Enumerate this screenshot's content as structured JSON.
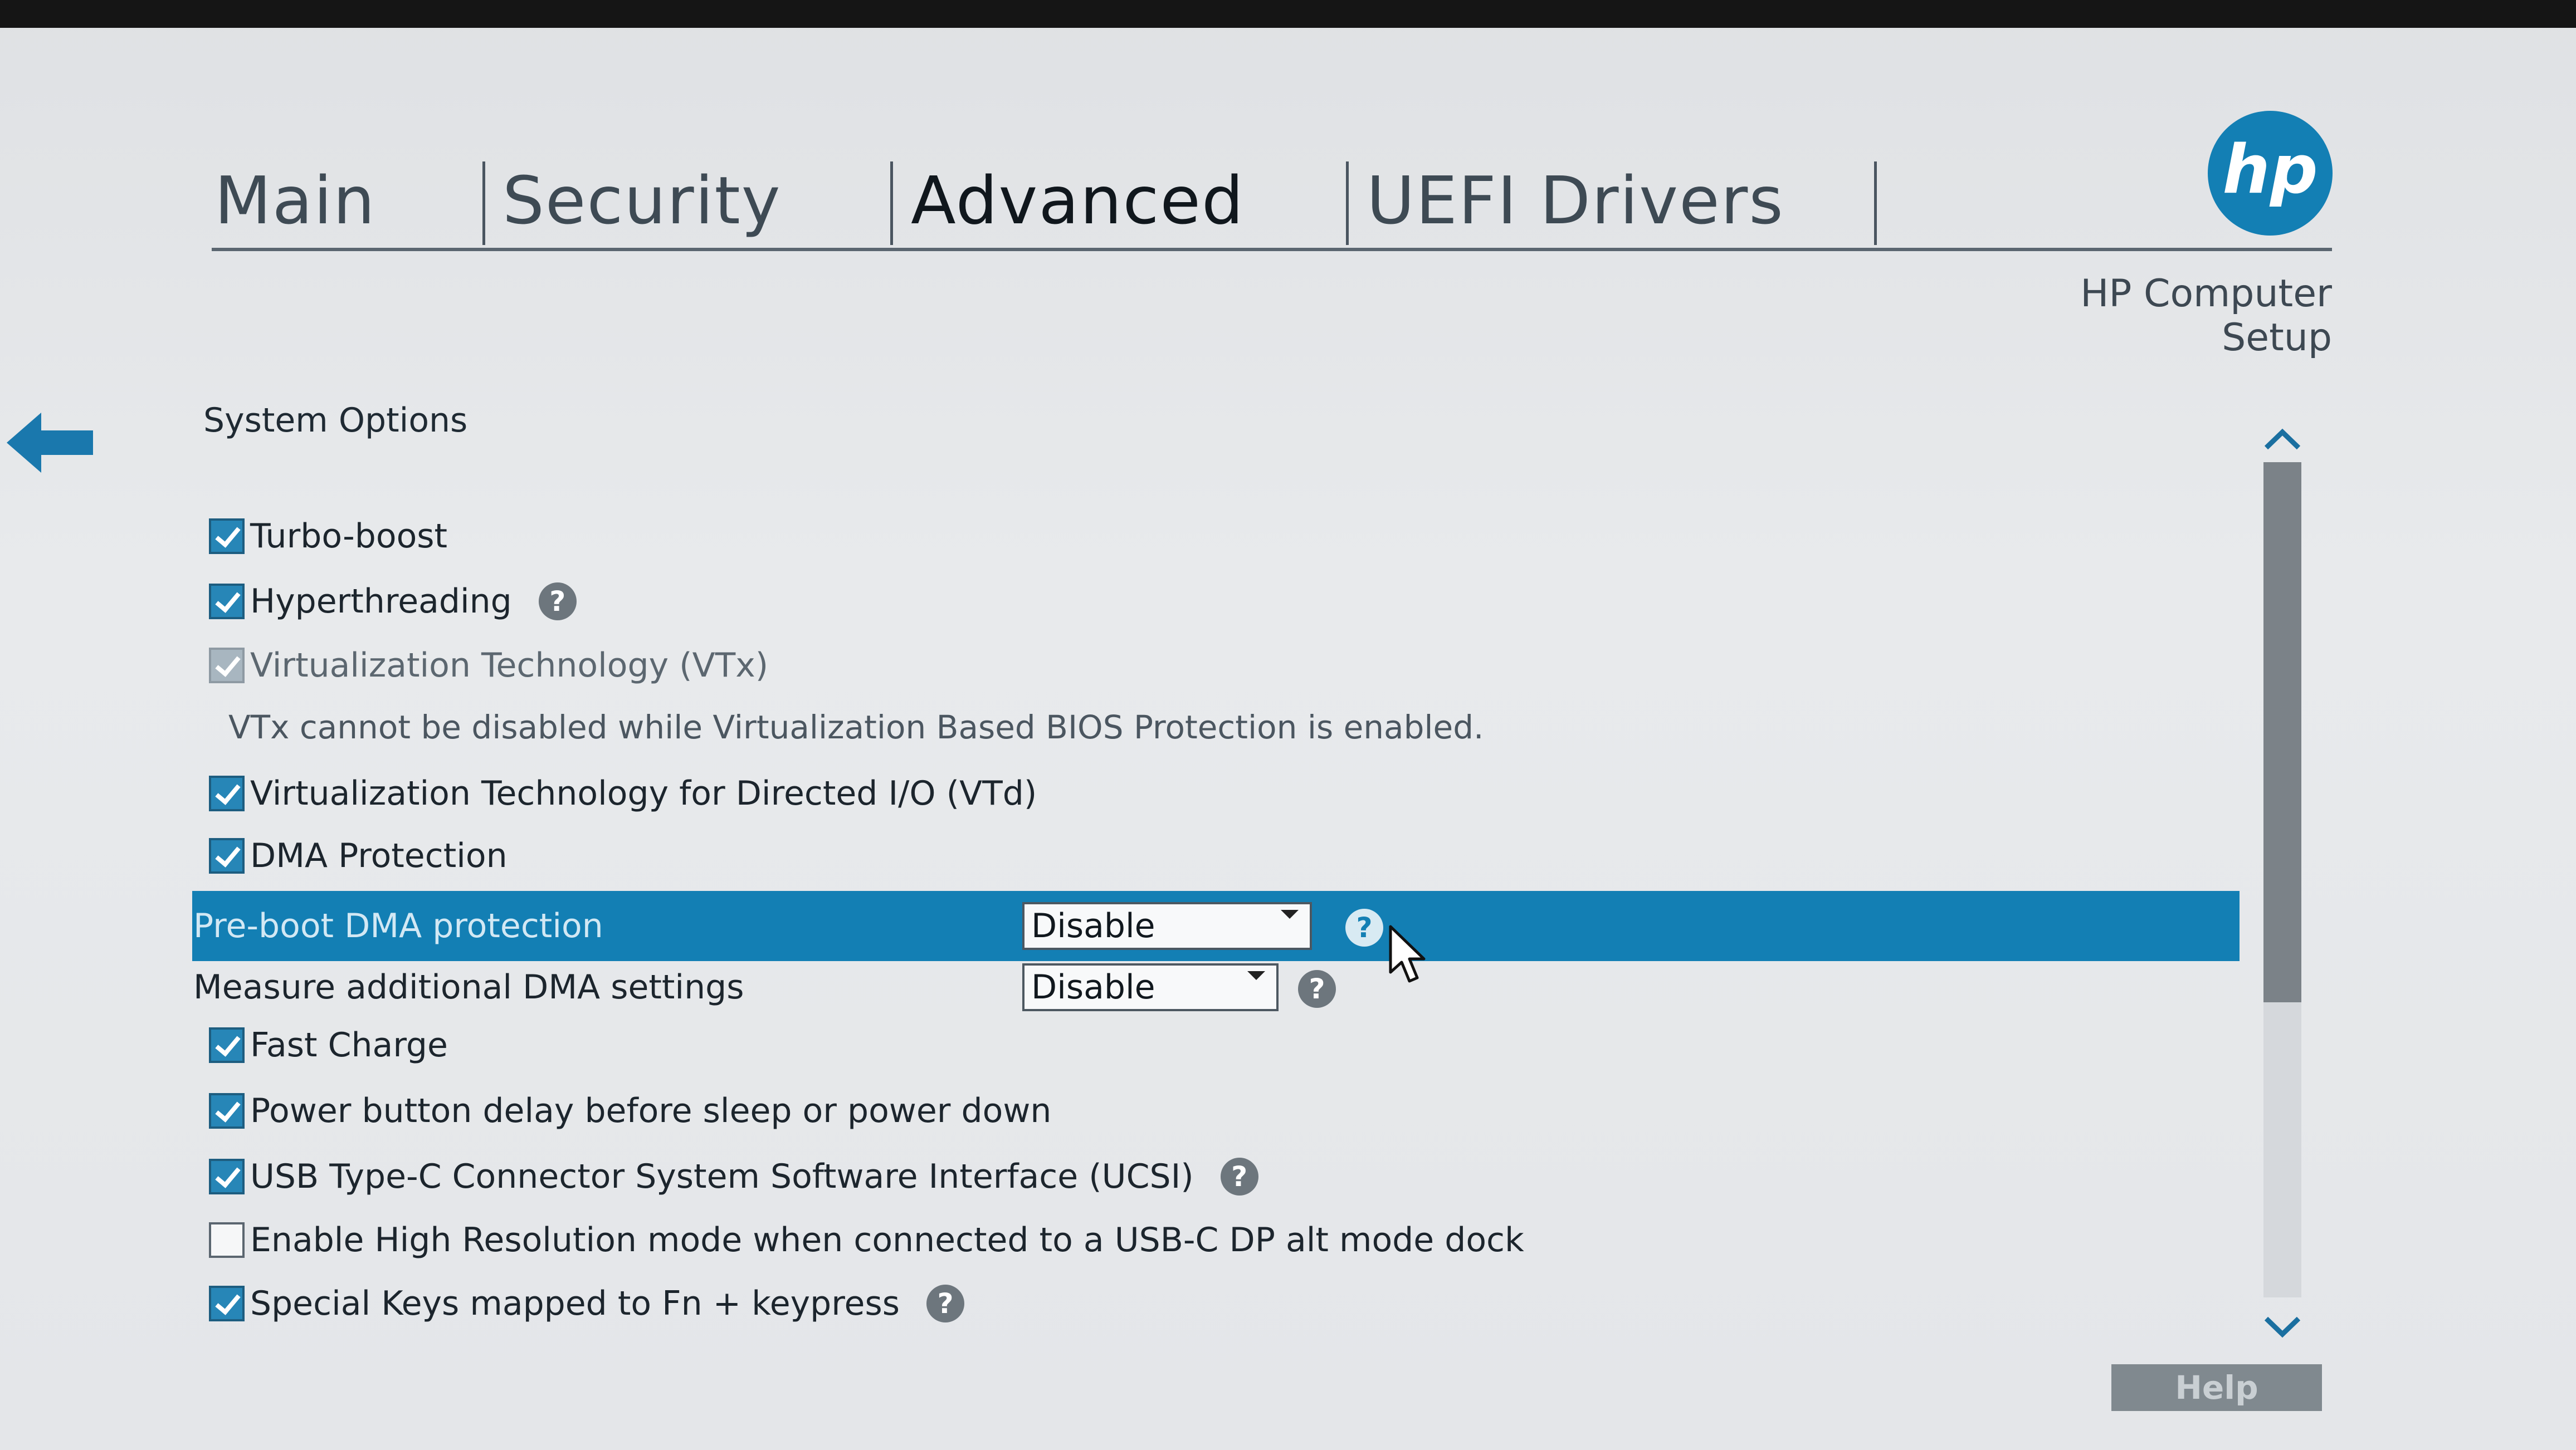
{
  "tabs": [
    {
      "label": "Main"
    },
    {
      "label": "Security"
    },
    {
      "label": "Advanced"
    },
    {
      "label": "UEFI Drivers"
    }
  ],
  "active_tab": "Advanced",
  "brand": {
    "logo_text": "hp",
    "product_name": "HP Computer Setup",
    "accent_color": "#137fb4"
  },
  "section_title": "System Options",
  "options": [
    {
      "label": "Turbo-boost",
      "checked": true,
      "disabled": false
    },
    {
      "label": "Hyperthreading",
      "checked": true,
      "disabled": false,
      "help_icon": "?"
    },
    {
      "label": "Virtualization Technology (VTx)",
      "checked": true,
      "disabled": true
    },
    {
      "label": "Virtualization Technology for Directed I/O (VTd)",
      "checked": true,
      "disabled": false
    },
    {
      "label": "DMA Protection",
      "checked": true,
      "disabled": false
    },
    {
      "label": "Fast Charge",
      "checked": true,
      "disabled": false
    },
    {
      "label": "Power button delay before sleep or power down",
      "checked": true,
      "disabled": false
    },
    {
      "label": "USB Type-C Connector System Software Interface (UCSI)",
      "checked": true,
      "disabled": false,
      "help_icon": "?"
    },
    {
      "label": "Enable High Resolution mode when connected to a USB-C DP alt mode dock",
      "checked": false,
      "disabled": false
    },
    {
      "label": "Special Keys mapped to Fn + keypress",
      "checked": true,
      "disabled": false,
      "help_icon": "?"
    }
  ],
  "vtx_note": "VTx cannot be disabled while Virtualization Based BIOS Protection is enabled.",
  "selects": [
    {
      "label": "Pre-boot DMA protection",
      "value": "Disable",
      "help_icon": "?",
      "highlighted": true
    },
    {
      "label": "Measure additional DMA settings",
      "value": "Disable",
      "help_icon": "?",
      "highlighted": false
    }
  ],
  "help_button": "Help",
  "icons": {
    "back": "back-arrow-icon",
    "scroll_up": "chevron-up-icon",
    "scroll_down": "chevron-down-icon",
    "cursor": "mouse-pointer-icon"
  }
}
